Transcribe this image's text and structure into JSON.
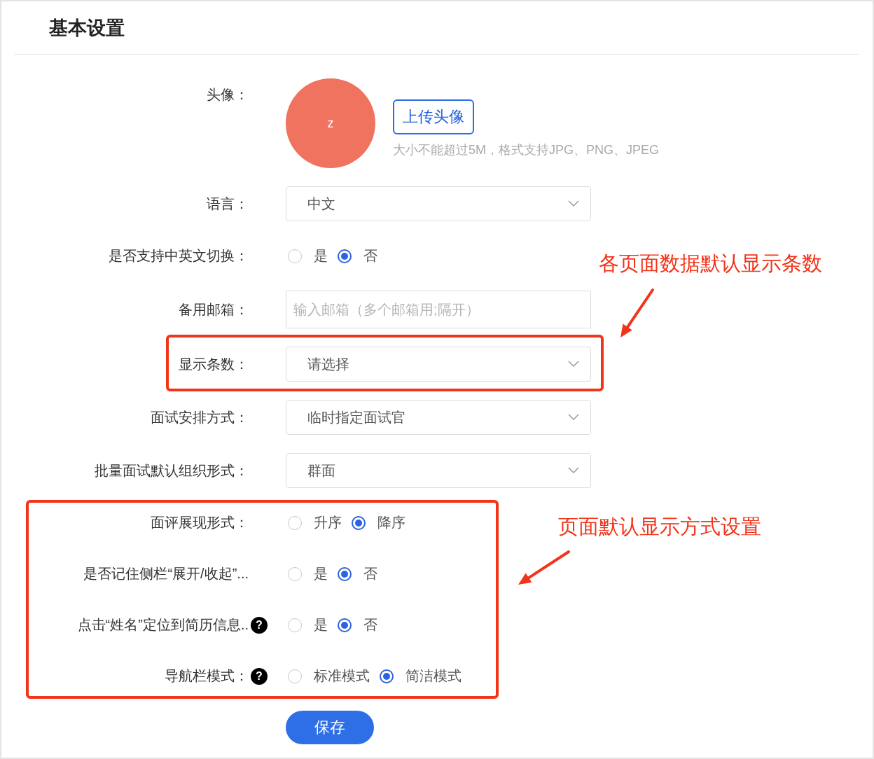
{
  "page": {
    "title": "基本设置"
  },
  "form": {
    "fields": [
      {
        "kind": "avatar",
        "label": "头像：",
        "avatar_letter": "z",
        "upload_button": "上传头像",
        "hint": "大小不能超过5M，格式支持JPG、PNG、JPEG"
      },
      {
        "kind": "select",
        "label": "语言：",
        "value": "中文"
      },
      {
        "kind": "radio",
        "label": "是否支持中英文切换：",
        "options": [
          {
            "label": "是",
            "selected": false
          },
          {
            "label": "否",
            "selected": true
          }
        ]
      },
      {
        "kind": "input",
        "label": "备用邮箱：",
        "placeholder": "输入邮箱（多个邮箱用;隔开）"
      },
      {
        "kind": "select",
        "label": "显示条数：",
        "value": "请选择"
      },
      {
        "kind": "select",
        "label": "面试安排方式：",
        "value": "临时指定面试官"
      },
      {
        "kind": "select",
        "label": "批量面试默认组织形式：",
        "value": "群面"
      },
      {
        "kind": "radio",
        "label": "面评展现形式：",
        "options": [
          {
            "label": "升序",
            "selected": false
          },
          {
            "label": "降序",
            "selected": true
          }
        ]
      },
      {
        "kind": "radio",
        "label": "是否记住侧栏“展开/收起”...",
        "options": [
          {
            "label": "是",
            "selected": false
          },
          {
            "label": "否",
            "selected": true
          }
        ]
      },
      {
        "kind": "radio",
        "label": "点击“姓名”定位到简历信息..",
        "help": "?",
        "options": [
          {
            "label": "是",
            "selected": false
          },
          {
            "label": "否",
            "selected": true
          }
        ]
      },
      {
        "kind": "radio",
        "label": "导航栏模式：",
        "help": "?",
        "options": [
          {
            "label": "标准模式",
            "selected": false
          },
          {
            "label": "简洁模式",
            "selected": true
          }
        ]
      }
    ],
    "save_button": "保存"
  },
  "annotations": [
    {
      "text": "各页面数据默认显示条数"
    },
    {
      "text": "页面默认显示方式设置"
    }
  ]
}
